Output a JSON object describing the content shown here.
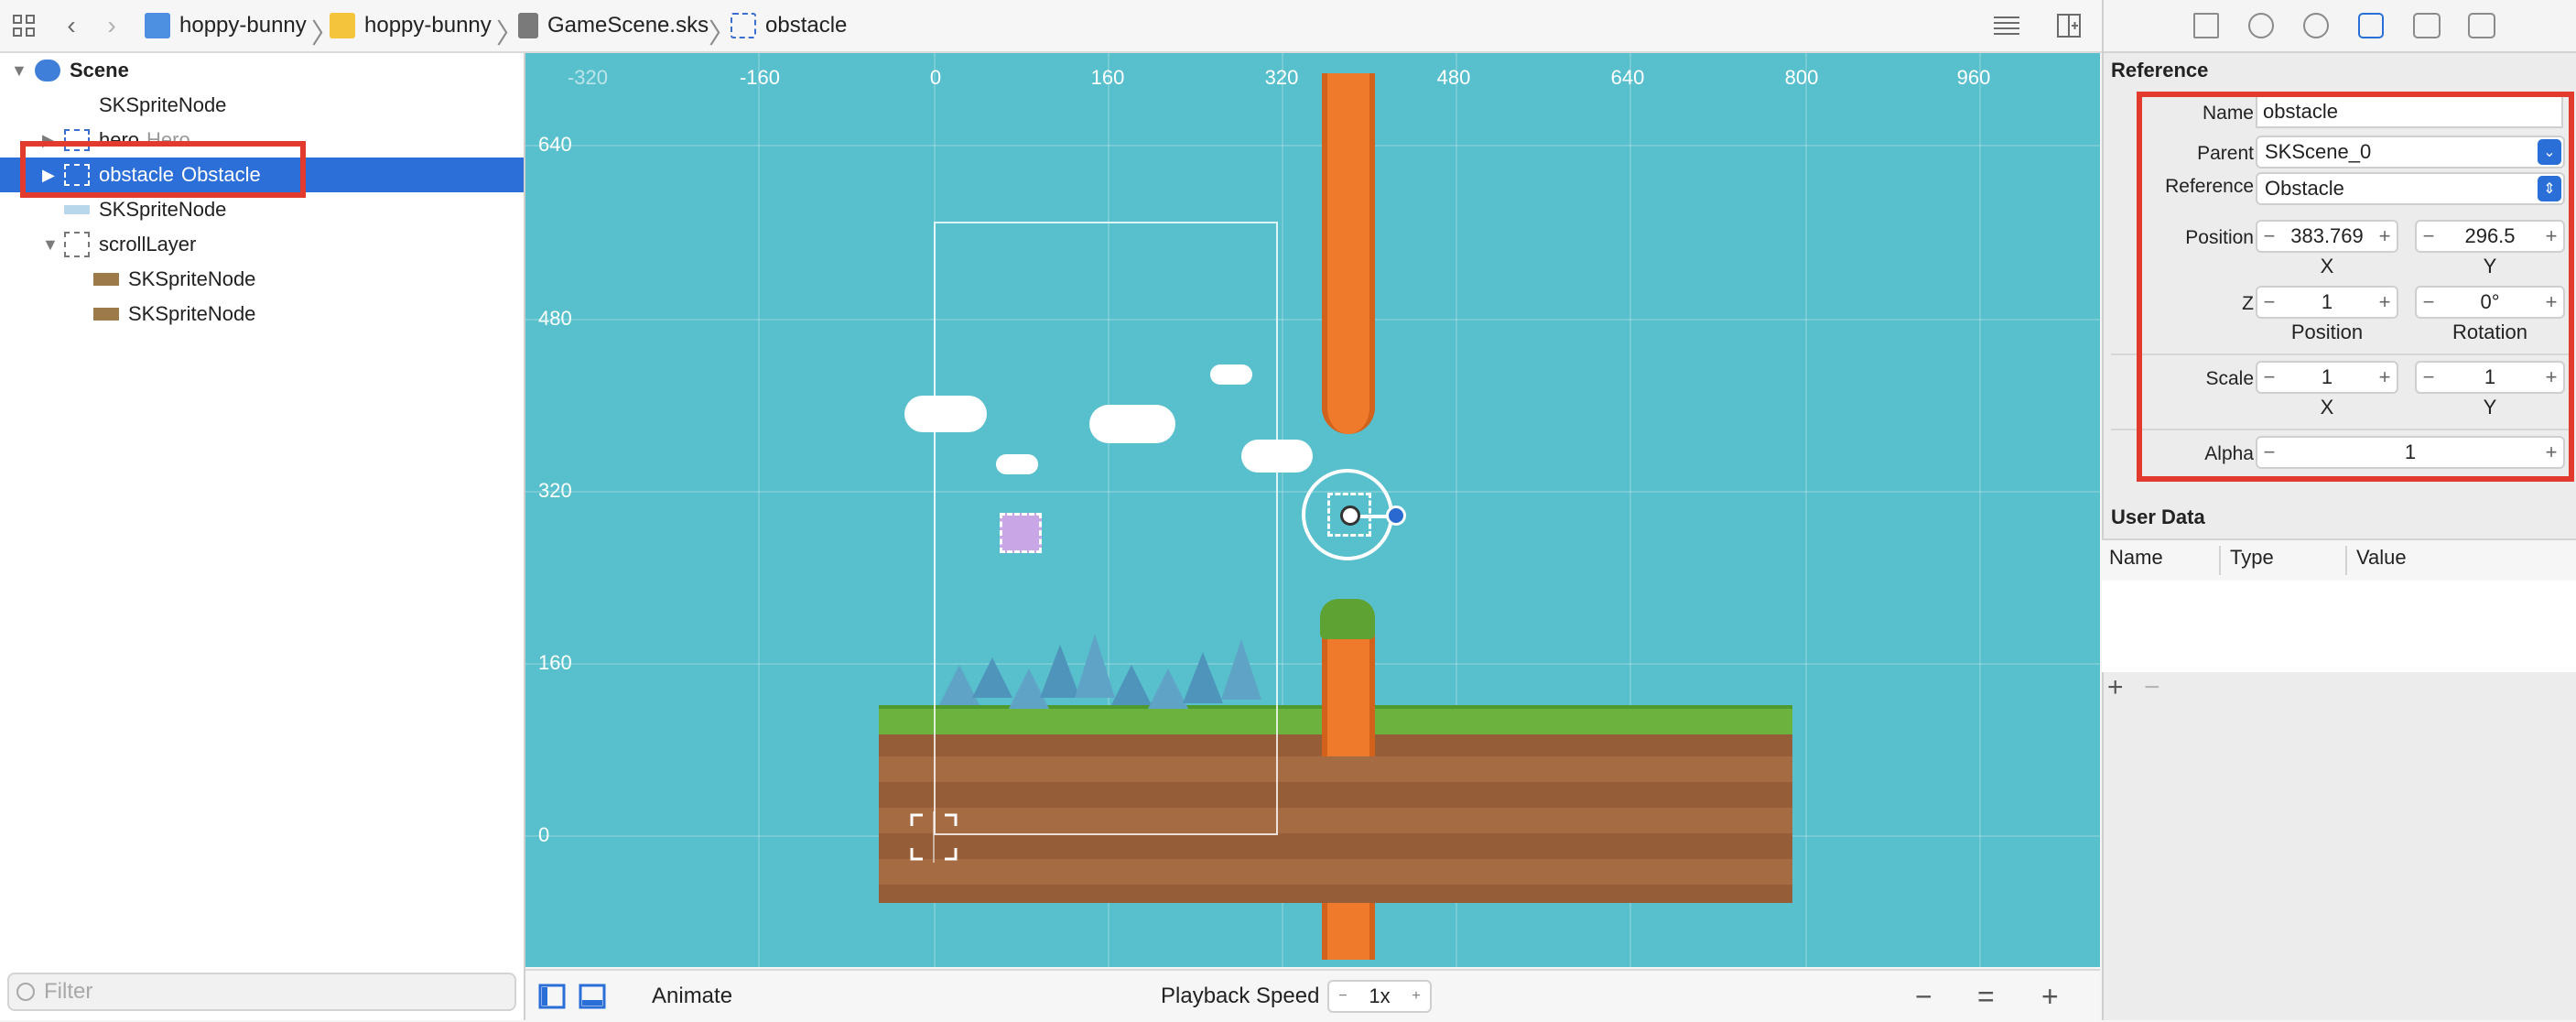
{
  "toolbar": {
    "breadcrumbs": [
      "hoppy-bunny",
      "hoppy-bunny",
      "GameScene.sks",
      "obstacle"
    ]
  },
  "navigator": {
    "items": [
      {
        "label": "Scene",
        "sub": ""
      },
      {
        "label": "SKSpriteNode",
        "sub": ""
      },
      {
        "label": "hero",
        "sub": "Hero"
      },
      {
        "label": "obstacle",
        "sub": "Obstacle"
      },
      {
        "label": "SKSpriteNode",
        "sub": ""
      },
      {
        "label": "scrollLayer",
        "sub": ""
      },
      {
        "label": "SKSpriteNode",
        "sub": ""
      },
      {
        "label": "SKSpriteNode",
        "sub": ""
      }
    ],
    "filter_placeholder": "Filter"
  },
  "canvas": {
    "x_ticks": [
      "-320",
      "-160",
      "0",
      "160",
      "320",
      "480",
      "640",
      "800",
      "960"
    ],
    "y_ticks": [
      "640",
      "480",
      "320",
      "160",
      "0"
    ]
  },
  "bottom_bar": {
    "animate_label": "Animate",
    "playback_label": "Playback Speed",
    "playback_value": "1x",
    "minus": "−",
    "plus": "+",
    "zoom_out": "−",
    "zoom_fit": "=",
    "zoom_in": "+"
  },
  "inspector": {
    "section_title": "Reference",
    "name_label": "Name",
    "name_value": "obstacle",
    "parent_label": "Parent",
    "parent_value": "SKScene_0",
    "reference_label": "Reference",
    "reference_value": "Obstacle",
    "position_label": "Position",
    "position_x": "383.769",
    "position_y": "296.5",
    "x_caption": "X",
    "y_caption": "Y",
    "z_label": "Z",
    "z_position": "1",
    "z_rotation": "0°",
    "position_caption": "Position",
    "rotation_caption": "Rotation",
    "scale_label": "Scale",
    "scale_x": "1",
    "scale_y": "1",
    "alpha_label": "Alpha",
    "alpha_value": "1",
    "user_data_title": "User Data",
    "ud_col_name": "Name",
    "ud_col_type": "Type",
    "ud_col_value": "Value",
    "ud_add": "+",
    "ud_remove": "−"
  },
  "colors": {
    "canvas_bg": "#58c0cc",
    "selection": "#2c6fd8",
    "annotation_red": "#e23a2c"
  }
}
